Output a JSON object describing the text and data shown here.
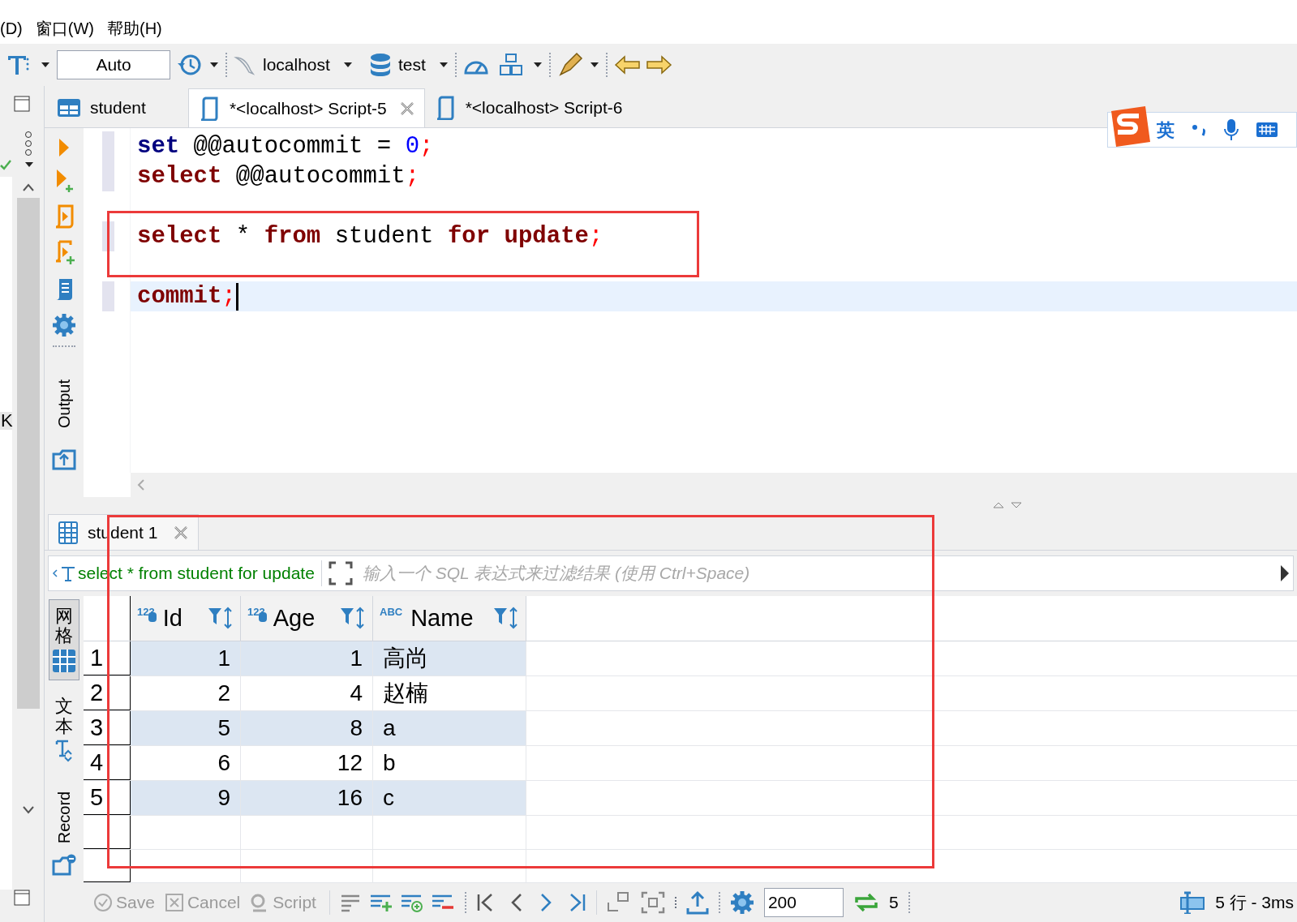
{
  "menu": [
    "(D)",
    "窗口(W)",
    "帮助(H)"
  ],
  "toolbar": {
    "transaction_mode": "Auto",
    "connection": "localhost",
    "database": "test"
  },
  "left_panel": {
    "fragment": "K"
  },
  "editor_tabs": [
    {
      "label": "student",
      "kind": "table",
      "selected": false
    },
    {
      "label": "*<localhost> Script-5",
      "kind": "script",
      "selected": true
    },
    {
      "label": "*<localhost> Script-6",
      "kind": "script",
      "selected": false
    }
  ],
  "ime_bar": {
    "mode": "英"
  },
  "code_lines": [
    {
      "current": false,
      "marked": true,
      "tokens": [
        {
          "kind": "statement",
          "text": "set"
        },
        {
          "kind": "plain",
          "text": " @@autocommit = "
        },
        {
          "kind": "number",
          "text": "0"
        },
        {
          "kind": "punct",
          "text": ";"
        }
      ]
    },
    {
      "current": false,
      "marked": true,
      "tokens": [
        {
          "kind": "keyword",
          "text": "select"
        },
        {
          "kind": "plain",
          "text": " @@autocommit"
        },
        {
          "kind": "punct",
          "text": ";"
        }
      ]
    },
    {
      "current": false,
      "marked": false
    },
    {
      "current": false,
      "marked": true,
      "tokens": [
        {
          "kind": "keyword",
          "text": "select"
        },
        {
          "kind": "plain",
          "text": " * "
        },
        {
          "kind": "keyword",
          "text": "from"
        },
        {
          "kind": "plain",
          "text": " student "
        },
        {
          "kind": "keyword",
          "text": "for update"
        },
        {
          "kind": "punct",
          "text": ";"
        }
      ]
    },
    {
      "current": false,
      "marked": false
    },
    {
      "current": true,
      "marked": true,
      "tokens": [
        {
          "kind": "keyword",
          "text": "commit"
        },
        {
          "kind": "punct",
          "text": ";"
        }
      ]
    }
  ],
  "side_tab": "Output",
  "highlights": [
    {
      "kind": "rectangle"
    },
    {
      "kind": "rectangle"
    }
  ],
  "results": {
    "tab": "student 1",
    "filter": {
      "query": "select * from student for update",
      "placeholder": "输入一个 SQL 表达式来过滤结果 (使用 Ctrl+Space)"
    },
    "view_tabs": [
      {
        "label": "网格",
        "kind": "cjk",
        "selected": true
      },
      {
        "label": "文本",
        "kind": "cjk",
        "selected": false
      },
      {
        "label": "Record",
        "kind": "latin",
        "selected": false
      }
    ],
    "columns": [
      {
        "name": "Id",
        "kind": "numeric",
        "type_label": "123"
      },
      {
        "name": "Age",
        "kind": "numeric",
        "type_label": "123"
      },
      {
        "name": "Name",
        "kind": "text",
        "type_label": "ABC"
      }
    ],
    "rows": [
      {
        "number": "1",
        "cells": [
          "1",
          "1",
          "高尚"
        ]
      },
      {
        "number": "2",
        "cells": [
          "2",
          "4",
          "赵楠"
        ]
      },
      {
        "number": "3",
        "cells": [
          "5",
          "8",
          "a"
        ]
      },
      {
        "number": "4",
        "cells": [
          "6",
          "12",
          "b"
        ]
      },
      {
        "number": "5",
        "cells": [
          "9",
          "16",
          "c"
        ]
      }
    ]
  },
  "bottom_bar": {
    "buttons": [
      {
        "label": "Save",
        "disabled": true
      },
      {
        "label": "Cancel",
        "disabled": true
      },
      {
        "label": "Script",
        "disabled": true
      }
    ],
    "fetch_size": "200",
    "refresh_count": "5",
    "status": "5 行 - 3ms"
  }
}
